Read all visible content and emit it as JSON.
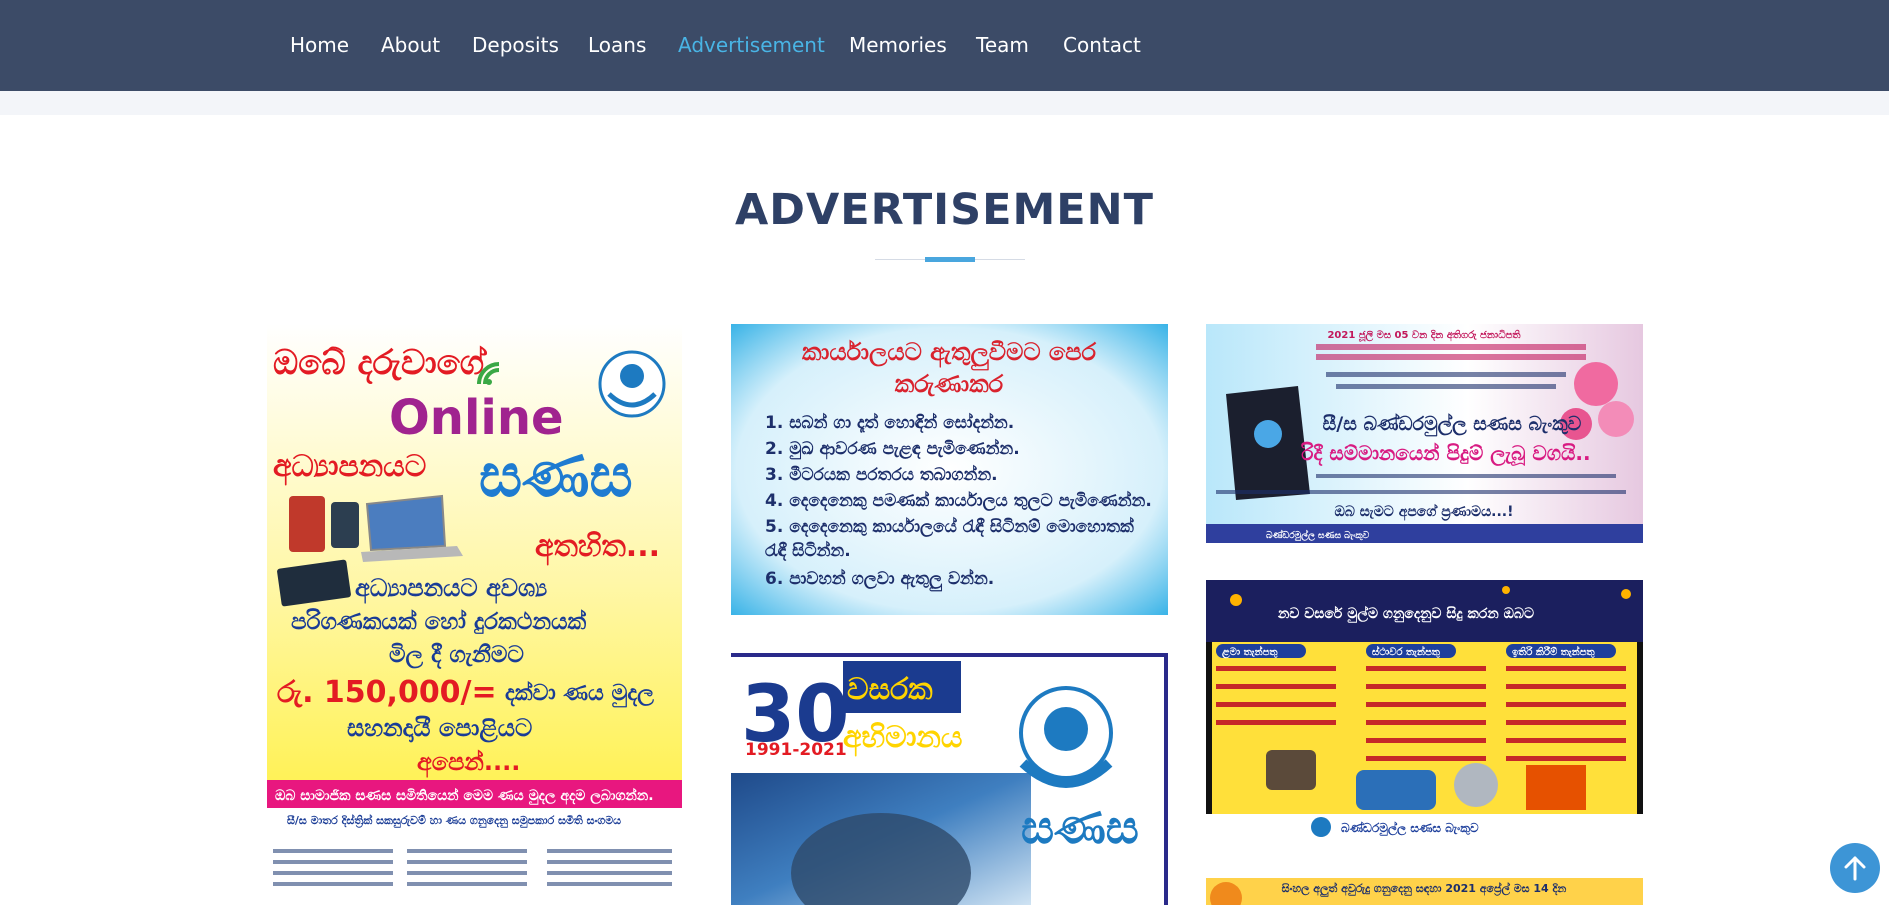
{
  "nav": {
    "items": [
      "Home",
      "About",
      "Deposits",
      "Loans",
      "Advertisement",
      "Memories",
      "Team",
      "Contact"
    ],
    "active": "Advertisement"
  },
  "section": {
    "title": "ADVERTISEMENT"
  },
  "ads": {
    "online": {
      "line1": "ඔබේ දරුවාගේ",
      "online": "Online",
      "line2": "අධ්‍යාපනයට",
      "brand": "සණස",
      "athahitha": "අතහිත...",
      "body1": "අධ්‍යාපනයට අවශ්‍ය",
      "body2": "පරිගණකයක් හෝ දුරකථනයක්",
      "body3": "මිල දී ගැනීමට",
      "amount": "රු. 150,000/=",
      "amount_tail": "දක්වා ණය මුදල",
      "body4": "සහනදායී පොළියට",
      "body5": "අපෙන්....",
      "banner": "ඔබ සාමාජික සණස සමිතියෙන් මෙම ණය මුදල අදම ලබාගන්න.",
      "footer": "සී/ස මාතර දිස්ත්‍රික් සකසුරුවම් හා ණය ගනුදෙනු සමුපකාර සමිති සංගමය"
    },
    "notice": {
      "title1": "කාර්යාලයට ඇතුලුවීමට පෙර",
      "title2": "කරුණාකර",
      "items": [
        "1. සබන් ගා දෑත් හොඳින් සෝදන්න.",
        "2. මුඛ ආවරණ පැළඳ පැමිණෙන්න.",
        "3. මීටරයක පරතරය තබාගන්න.",
        "4. දෙදෙනෙකු පමණක් කාර්යාලය තුලට පැමිණෙන්න.",
        "5. දෙදෙනෙකු කාර්යාලයේ රැඳී සිටිනම් මොහොතක්",
        "   රැඳී සිටින්න.",
        "6. පාවහන් ගලවා ඇතුලු වන්න."
      ]
    },
    "anniversary": {
      "number": "30",
      "word1": "වසරක",
      "word2": "අභිමානය",
      "years": "1991-2021",
      "brand": "සණස"
    },
    "award": {
      "top1": "2021 ජූලි මස 05 වන දින අතිගරු ජනාධිපති",
      "name": "සී/ස බණ්ඩරමුල්ල සණස බැංකුව",
      "slogan": "රිදී සම්මානයෙන් පිදුම් ලැබූ වගයි..",
      "thanks": "ඔබ සැමට අපගේ ප්‍රණාමය...!",
      "footer": "බණ්ඩරමුල්ල සණස බැංකුව"
    },
    "deposits": {
      "header": "නව වසරේ මුල්ම ගනුදෙනුව සිදු කරන ඔබට",
      "cols": [
        "ළමා තැන්පතු",
        "ස්ථාවර තැන්පතු",
        "ඉතිරි කිරීම් තැන්පතු"
      ],
      "footer": "බණ්ඩරමුල්ල සණස බැංකුව"
    },
    "partial": {
      "text": "සිංහල අලුත් අවුරුදු ගනුදෙනු සඳහා 2021 අප්‍රේල් මස 14 දින"
    }
  },
  "colors": {
    "topbar": "#3c4b67",
    "accent": "#49b4e5",
    "title": "#2e4066",
    "backtop": "#3d95d6"
  },
  "icons": {
    "back_to_top": "arrow-up-icon"
  }
}
